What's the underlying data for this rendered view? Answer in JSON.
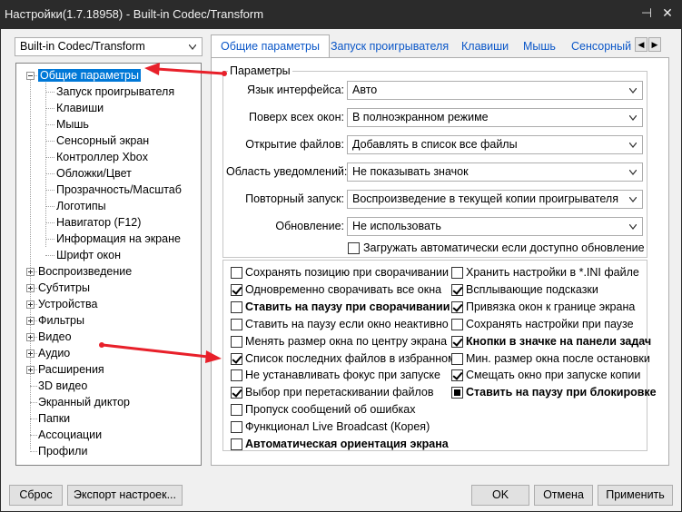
{
  "window": {
    "title": "Настройки(1.7.18958) - Built-in Codec/Transform",
    "pin_glyph": "⊣",
    "close_glyph": "✕"
  },
  "profile_combo": {
    "value": "Built-in Codec/Transform"
  },
  "tree": {
    "items": [
      {
        "label": "Общие параметры",
        "level": 0,
        "expander": "minus",
        "selected": true
      },
      {
        "label": "Запуск проигрывателя",
        "level": 1
      },
      {
        "label": "Клавиши",
        "level": 1
      },
      {
        "label": "Мышь",
        "level": 1
      },
      {
        "label": "Сенсорный экран",
        "level": 1
      },
      {
        "label": "Контроллер Xbox",
        "level": 1
      },
      {
        "label": "Обложки/Цвет",
        "level": 1
      },
      {
        "label": "Прозрачность/Масштаб",
        "level": 1
      },
      {
        "label": "Логотипы",
        "level": 1
      },
      {
        "label": "Навигатор (F12)",
        "level": 1
      },
      {
        "label": "Информация на экране",
        "level": 1
      },
      {
        "label": "Шрифт окон",
        "level": 1
      },
      {
        "label": "Воспроизведение",
        "level": 0,
        "expander": "plus"
      },
      {
        "label": "Субтитры",
        "level": 0,
        "expander": "plus"
      },
      {
        "label": "Устройства",
        "level": 0,
        "expander": "plus"
      },
      {
        "label": "Фильтры",
        "level": 0,
        "expander": "plus"
      },
      {
        "label": "Видео",
        "level": 0,
        "expander": "plus"
      },
      {
        "label": "Аудио",
        "level": 0,
        "expander": "plus"
      },
      {
        "label": "Расширения",
        "level": 0,
        "expander": "plus"
      },
      {
        "label": "3D видео",
        "level": 0
      },
      {
        "label": "Экранный диктор",
        "level": 0
      },
      {
        "label": "Папки",
        "level": 0
      },
      {
        "label": "Ассоциации",
        "level": 0
      },
      {
        "label": "Профили",
        "level": 0
      }
    ]
  },
  "tabs": [
    {
      "label": "Общие параметры",
      "active": true
    },
    {
      "label": "Запуск проигрывателя"
    },
    {
      "label": "Клавиши"
    },
    {
      "label": "Мышь"
    },
    {
      "label": "Сенсорный"
    }
  ],
  "tab_scroll": {
    "left": "◀",
    "right": "▶"
  },
  "params": {
    "group_title": "Параметры",
    "rows": [
      {
        "label": "Язык интерфейса:",
        "value": "Авто"
      },
      {
        "label": "Поверх всех окон:",
        "value": "В полноэкранном режиме"
      },
      {
        "label": "Открытие файлов:",
        "value": "Добавлять в список все файлы"
      },
      {
        "label": "Область уведомлений:",
        "value": "Не показывать значок"
      },
      {
        "label": "Повторный запуск:",
        "value": "Воспроизведение в текущей копии проигрывателя"
      },
      {
        "label": "Обновление:",
        "value": "Не использовать"
      }
    ],
    "auto_update": {
      "label": "Загружать автоматически если доступно обновление",
      "checked": false
    }
  },
  "checks_left": [
    {
      "label": "Сохранять позицию при сворачивании",
      "state": "unchecked"
    },
    {
      "label": "Одновременно сворачивать все окна",
      "state": "checked"
    },
    {
      "label": "Ставить на паузу при сворачивании",
      "state": "unchecked",
      "bold": true
    },
    {
      "label": "Ставить на паузу если окно неактивно",
      "state": "unchecked"
    },
    {
      "label": "Менять размер окна по центру экрана",
      "state": "unchecked"
    },
    {
      "label": "Список последних файлов в избранном",
      "state": "checked"
    },
    {
      "label": "Не устанавливать фокус при запуске",
      "state": "unchecked"
    },
    {
      "label": "Выбор при перетаскивании файлов",
      "state": "checked"
    },
    {
      "label": "Пропуск сообщений об ошибках",
      "state": "unchecked"
    },
    {
      "label": "Функционал Live Broadcast (Корея)",
      "state": "unchecked"
    },
    {
      "label": "Автоматическая ориентация экрана",
      "state": "unchecked",
      "bold": true
    }
  ],
  "checks_right": [
    {
      "label": "Хранить настройки в *.INI файле",
      "state": "unchecked"
    },
    {
      "label": "Всплывающие подсказки",
      "state": "checked"
    },
    {
      "label": "Привязка окон к границе экрана",
      "state": "checked"
    },
    {
      "label": "Сохранять настройки при паузе",
      "state": "unchecked"
    },
    {
      "label": "Кнопки в значке на панели задач",
      "state": "checked",
      "bold": true
    },
    {
      "label": "Мин. размер окна после остановки",
      "state": "unchecked"
    },
    {
      "label": "Смещать окно при запуске копии",
      "state": "checked"
    },
    {
      "label": "Ставить на паузу при блокировке",
      "state": "filled",
      "bold": true
    }
  ],
  "buttons": {
    "reset": "Сброс",
    "export": "Экспорт настроек...",
    "ok": "OK",
    "cancel": "Отмена",
    "apply": "Применить"
  },
  "colors": {
    "titlebar": "#2b2b2b",
    "selection": "#0078d7",
    "tab_text": "#0b57c8",
    "annotation_arrow": "#e8202a"
  }
}
